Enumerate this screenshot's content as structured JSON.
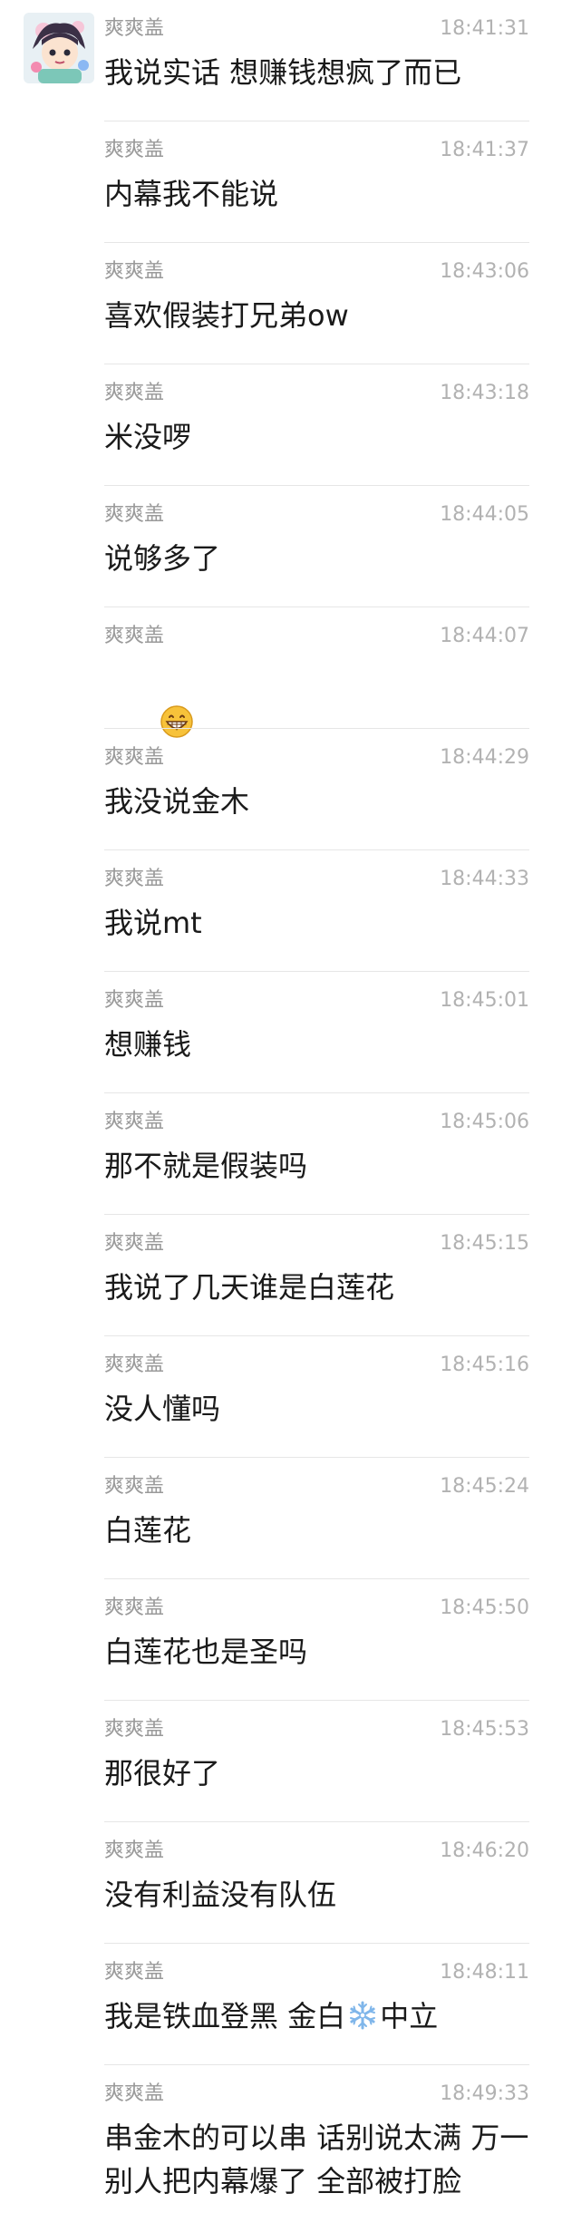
{
  "sender": "爽爽盖",
  "messages": [
    {
      "time": "18:41:31",
      "text": "我说实话 想赚钱想疯了而已"
    },
    {
      "time": "18:41:37",
      "text": "内幕我不能说"
    },
    {
      "time": "18:43:06",
      "text": "喜欢假装打兄弟ow"
    },
    {
      "time": "18:43:18",
      "text": "米没啰"
    },
    {
      "time": "18:44:05",
      "text": "说够多了"
    },
    {
      "time": "18:44:07",
      "text": "",
      "emoji": "grinning-face-emoji"
    },
    {
      "time": "18:44:29",
      "text": "我没说金木"
    },
    {
      "time": "18:44:33",
      "text": "我说mt"
    },
    {
      "time": "18:45:01",
      "text": "想赚钱"
    },
    {
      "time": "18:45:06",
      "text": "那不就是假装吗"
    },
    {
      "time": "18:45:15",
      "text": "我说了几天谁是白莲花"
    },
    {
      "time": "18:45:16",
      "text": "没人懂吗"
    },
    {
      "time": "18:45:24",
      "text": "白莲花"
    },
    {
      "time": "18:45:50",
      "text": "白莲花也是圣吗"
    },
    {
      "time": "18:45:53",
      "text": "那很好了"
    },
    {
      "time": "18:46:20",
      "text": "没有利益没有队伍"
    },
    {
      "time": "18:48:11",
      "text_before": "我是铁血登黑 金白",
      "emoji": "snowflake-emoji",
      "text_after": "中立"
    },
    {
      "time": "18:49:33",
      "text": "串金木的可以串 话别说太满 万一别人把内幕爆了 全部被打脸"
    }
  ]
}
